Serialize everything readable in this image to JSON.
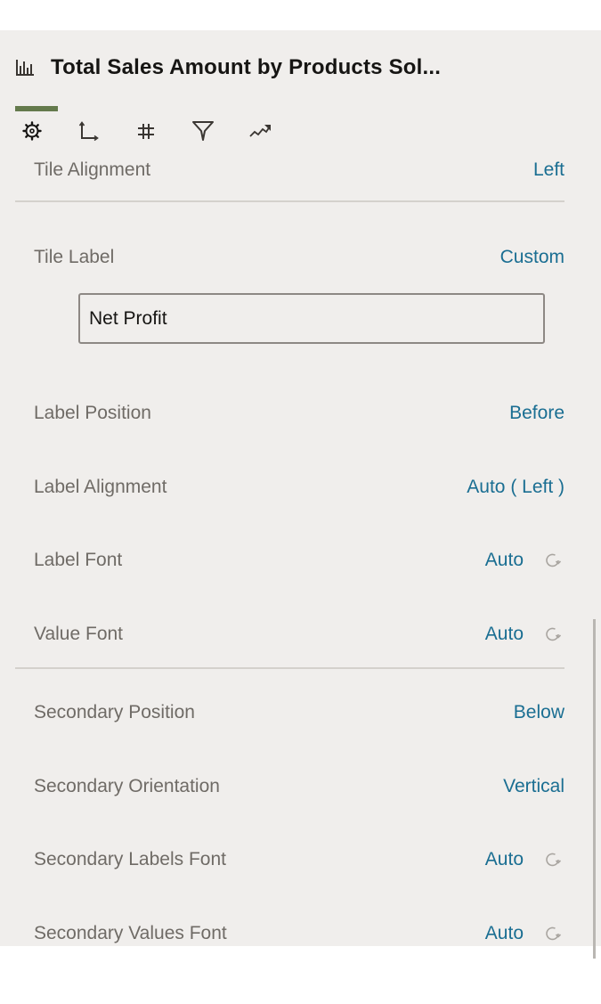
{
  "header": {
    "icon": "bar-chart-icon",
    "title": "Total Sales Amount by Products Sol..."
  },
  "tabs": [
    {
      "name": "general",
      "icon": "gear-icon",
      "active": true
    },
    {
      "name": "axis",
      "icon": "axis-icon",
      "active": false
    },
    {
      "name": "number-format",
      "icon": "hash-icon",
      "active": false
    },
    {
      "name": "filters",
      "icon": "filter-icon",
      "active": false
    },
    {
      "name": "analytics",
      "icon": "trend-icon",
      "active": false
    }
  ],
  "colors": {
    "accent": "#647a4c",
    "value_link": "#1a6e92",
    "label": "#6f6b66",
    "panel_bg": "#f0eeec"
  },
  "properties": {
    "tile_alignment": {
      "label": "Tile Alignment",
      "value": "Left"
    },
    "tile_label": {
      "label": "Tile Label",
      "value": "Custom",
      "input_value": "Net Profit"
    },
    "label_position": {
      "label": "Label Position",
      "value": "Before"
    },
    "label_alignment": {
      "label": "Label Alignment",
      "value": "Auto ( Left )"
    },
    "label_font": {
      "label": "Label Font",
      "value": "Auto",
      "reset_icon": "reset-icon"
    },
    "value_font": {
      "label": "Value Font",
      "value": "Auto",
      "reset_icon": "reset-icon"
    },
    "secondary_position": {
      "label": "Secondary Position",
      "value": "Below"
    },
    "secondary_orientation": {
      "label": "Secondary Orientation",
      "value": "Vertical"
    },
    "secondary_labels_font": {
      "label": "Secondary Labels Font",
      "value": "Auto",
      "reset_icon": "reset-icon"
    },
    "secondary_values_font": {
      "label": "Secondary Values Font",
      "value": "Auto",
      "reset_icon": "reset-icon"
    }
  }
}
